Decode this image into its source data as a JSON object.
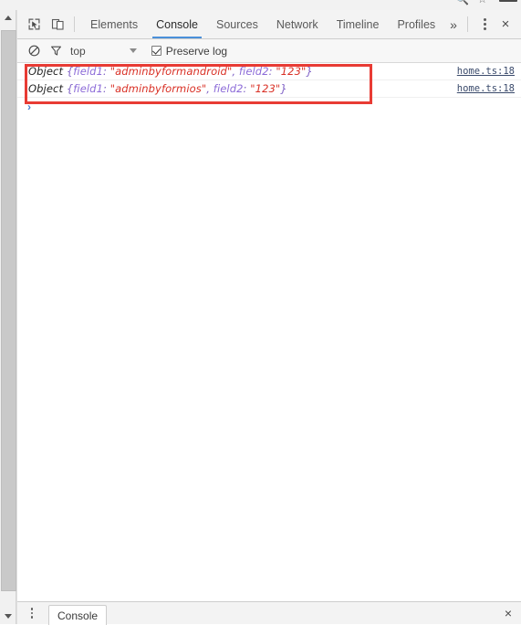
{
  "browser_chrome": {
    "search_icon": "search-icon",
    "bookmark_icon": "star-icon",
    "minimize_label": ""
  },
  "devtools": {
    "toolbar": {
      "inspect_icon": "inspect-element-icon",
      "device_icon": "device-toolbar-icon",
      "tabs": [
        {
          "label": "Elements",
          "active": false
        },
        {
          "label": "Console",
          "active": true
        },
        {
          "label": "Sources",
          "active": false
        },
        {
          "label": "Network",
          "active": false
        },
        {
          "label": "Timeline",
          "active": false
        },
        {
          "label": "Profiles",
          "active": false
        }
      ],
      "more_tabs_label": "»",
      "menu_icon": "kebab-menu-icon",
      "close_label": "×"
    },
    "filter_bar": {
      "clear_console_icon": "clear-console-icon",
      "filter_icon": "filter-funnel-icon",
      "context_value": "top",
      "preserve_log_label": "Preserve log",
      "preserve_log_checked": true
    },
    "console": {
      "messages": [
        {
          "object_label": "Object",
          "open_brace": "{",
          "key1": "field1",
          "sep1": ": ",
          "value1": "\"adminbyformandroid\"",
          "comma": ", ",
          "key2": "field2",
          "sep2": ": ",
          "value2": "\"123\"",
          "close_brace": "}",
          "source_link": "home.ts:18"
        },
        {
          "object_label": "Object",
          "open_brace": "{",
          "key1": "field1",
          "sep1": ": ",
          "value1": "\"adminbyformios\"",
          "comma": ", ",
          "key2": "field2",
          "sep2": ": ",
          "value2": "\"123\"",
          "close_brace": "}",
          "source_link": "home.ts:18"
        }
      ],
      "prompt_caret": "›"
    },
    "drawer": {
      "menu_icon": "kebab-menu-icon",
      "tab_label": "Console",
      "close_label": "×"
    }
  },
  "annotation": {
    "highlight_color": "#e83b34"
  },
  "colors": {
    "accent_tab_underline": "#4a90d9",
    "string_token": "#d93025",
    "key_token": "#8c6bd8",
    "link": "#3a4a6b",
    "toolbar_bg": "#f3f3f3"
  }
}
